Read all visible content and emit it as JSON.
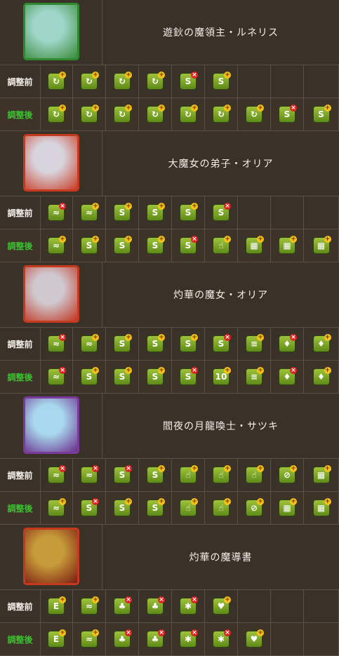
{
  "labels": {
    "before": "調整前",
    "after": "調整後"
  },
  "colors": {
    "background": "#3a3128",
    "after_label": "#39c22e",
    "awakening_bg": "#7aa82a"
  },
  "cards": [
    {
      "name": "遊鈥の魔領主・ルネリス",
      "portrait": {
        "main_color": "#9fd6c9",
        "accent": "#3a8b3a",
        "border": "#2f8a2f"
      },
      "before": [
        {
          "icon": "skill-boost-icon",
          "sym": "↻",
          "mod": "plus"
        },
        {
          "icon": "skill-boost-icon",
          "sym": "↻",
          "mod": "plus"
        },
        {
          "icon": "skill-boost-icon",
          "sym": "↻",
          "mod": "plus"
        },
        {
          "icon": "skill-boost-icon",
          "sym": "↻",
          "mod": "plus"
        },
        {
          "icon": "bind-resist-icon",
          "sym": "S",
          "mod": "cross"
        },
        {
          "icon": "bind-resist-icon",
          "sym": "S",
          "mod": "plus"
        }
      ],
      "after": [
        {
          "icon": "skill-boost-icon",
          "sym": "↻",
          "mod": "plus"
        },
        {
          "icon": "skill-boost-icon",
          "sym": "↻",
          "mod": "plus"
        },
        {
          "icon": "skill-boost-icon",
          "sym": "↻",
          "mod": "plus"
        },
        {
          "icon": "skill-boost-icon",
          "sym": "↻",
          "mod": "plus"
        },
        {
          "icon": "skill-boost-icon",
          "sym": "↻",
          "mod": "plus"
        },
        {
          "icon": "skill-boost-icon",
          "sym": "↻",
          "mod": "plus"
        },
        {
          "icon": "skill-boost-icon",
          "sym": "↻",
          "mod": "plus"
        },
        {
          "icon": "bind-resist-icon",
          "sym": "S",
          "mod": "cross"
        },
        {
          "icon": "bind-resist-icon",
          "sym": "S",
          "mod": "plus"
        }
      ]
    },
    {
      "name": "大魔女の弟子・オリア",
      "portrait": {
        "main_color": "#d8d4de",
        "accent": "#c93b22",
        "border": "#c33a1c"
      },
      "before": [
        {
          "icon": "bind-recovery-icon",
          "sym": "≈",
          "mod": "cross"
        },
        {
          "icon": "bind-recovery-icon",
          "sym": "≈",
          "mod": "plus"
        },
        {
          "icon": "orb-enhance-icon",
          "sym": "S",
          "mod": "plus"
        },
        {
          "icon": "orb-enhance-icon",
          "sym": "S",
          "mod": "plus"
        },
        {
          "icon": "bind-resist-icon",
          "sym": "S",
          "mod": "plus"
        },
        {
          "icon": "bind-resist-icon",
          "sym": "S",
          "mod": "cross"
        }
      ],
      "after": [
        {
          "icon": "bind-recovery-icon",
          "sym": "≈",
          "mod": "plus"
        },
        {
          "icon": "orb-enhance-icon",
          "sym": "S",
          "mod": "plus"
        },
        {
          "icon": "orb-enhance-icon",
          "sym": "S",
          "mod": "plus"
        },
        {
          "icon": "bind-resist-icon",
          "sym": "S",
          "mod": "plus"
        },
        {
          "icon": "bind-resist-icon",
          "sym": "S",
          "mod": "cross"
        },
        {
          "icon": "extend-time-icon",
          "sym": "☝",
          "mod": "plus"
        },
        {
          "icon": "damage-up-icon",
          "sym": "▦",
          "mod": "plus"
        },
        {
          "icon": "damage-up-icon",
          "sym": "▦",
          "mod": "plus"
        },
        {
          "icon": "damage-up-icon",
          "sym": "▦",
          "mod": "plus"
        }
      ]
    },
    {
      "name": "灼華の魔女・オリア",
      "portrait": {
        "main_color": "#cfc8cf",
        "accent": "#c23520",
        "border": "#c33a1c"
      },
      "before": [
        {
          "icon": "bind-recovery-icon",
          "sym": "≈",
          "mod": "cross"
        },
        {
          "icon": "bind-recovery-icon",
          "sym": "≈",
          "mod": "plus"
        },
        {
          "icon": "orb-enhance-icon",
          "sym": "S",
          "mod": "plus"
        },
        {
          "icon": "orb-enhance-icon",
          "sym": "S",
          "mod": "plus"
        },
        {
          "icon": "bind-resist-icon",
          "sym": "S",
          "mod": "plus"
        },
        {
          "icon": "bind-resist-icon",
          "sym": "S",
          "mod": "cross"
        },
        {
          "icon": "combo-icon",
          "sym": "≡",
          "mod": "plus"
        },
        {
          "icon": "heart-icon",
          "sym": "♦",
          "mod": "cross"
        },
        {
          "icon": "heart-icon",
          "sym": "♦",
          "mod": "plus"
        }
      ],
      "after": [
        {
          "icon": "bind-recovery-icon",
          "sym": "≈",
          "mod": "cross"
        },
        {
          "icon": "orb-enhance-icon",
          "sym": "S",
          "mod": "plus"
        },
        {
          "icon": "orb-enhance-icon",
          "sym": "S",
          "mod": "plus"
        },
        {
          "icon": "orb-enhance-icon",
          "sym": "S",
          "mod": "plus"
        },
        {
          "icon": "bind-resist-icon",
          "sym": "S",
          "mod": "cross"
        },
        {
          "icon": "ten-combo-icon",
          "sym": "10",
          "mod": "plus"
        },
        {
          "icon": "combo-icon",
          "sym": "≡",
          "mod": "plus"
        },
        {
          "icon": "heart-icon",
          "sym": "♦",
          "mod": "cross"
        },
        {
          "icon": "heart-icon",
          "sym": "♦",
          "mod": "plus"
        }
      ]
    },
    {
      "name": "閻夜の月龍喚士・サツキ",
      "portrait": {
        "main_color": "#a8d8ee",
        "accent": "#6a2c8c",
        "border": "#7a3a9a"
      },
      "before": [
        {
          "icon": "bind-recovery-icon",
          "sym": "≈",
          "mod": "cross"
        },
        {
          "icon": "bind-recovery-icon",
          "sym": "≈",
          "mod": "cross"
        },
        {
          "icon": "bind-resist-icon",
          "sym": "S",
          "mod": "cross"
        },
        {
          "icon": "orb-enhance-icon",
          "sym": "S",
          "mod": "plus"
        },
        {
          "icon": "extend-time-icon",
          "sym": "☝",
          "mod": "plus"
        },
        {
          "icon": "extend-time-icon",
          "sym": "☝",
          "mod": "plus"
        },
        {
          "icon": "extend-time-icon",
          "sym": "☝",
          "mod": "plus"
        },
        {
          "icon": "guard-break-icon",
          "sym": "⊘",
          "mod": "plus"
        },
        {
          "icon": "damage-up-icon",
          "sym": "▦",
          "mod": "plus"
        }
      ],
      "after": [
        {
          "icon": "bind-recovery-icon",
          "sym": "≈",
          "mod": "plus"
        },
        {
          "icon": "bind-resist-icon",
          "sym": "S",
          "mod": "cross"
        },
        {
          "icon": "orb-enhance-icon",
          "sym": "S",
          "mod": "plus"
        },
        {
          "icon": "orb-enhance-icon",
          "sym": "S",
          "mod": "plus"
        },
        {
          "icon": "extend-time-icon",
          "sym": "☝",
          "mod": "plus"
        },
        {
          "icon": "extend-time-icon",
          "sym": "☝",
          "mod": "plus"
        },
        {
          "icon": "guard-break-icon",
          "sym": "⊘",
          "mod": "plus"
        },
        {
          "icon": "damage-up-icon",
          "sym": "▦",
          "mod": "plus"
        },
        {
          "icon": "damage-up-icon",
          "sym": "▦",
          "mod": "plus"
        }
      ]
    },
    {
      "name": "灼華の魔導書",
      "portrait": {
        "main_color": "#c79a3a",
        "accent": "#7a1a10",
        "border": "#c33a1c"
      },
      "before": [
        {
          "icon": "enhanced-attack-icon",
          "sym": "E",
          "mod": "plus"
        },
        {
          "icon": "bind-recovery-icon",
          "sym": "≈",
          "mod": "plus"
        },
        {
          "icon": "dark-resist-icon",
          "sym": "♣",
          "mod": "cross"
        },
        {
          "icon": "dark-resist-icon",
          "sym": "♣",
          "mod": "cross"
        },
        {
          "icon": "poison-resist-icon",
          "sym": "✱",
          "mod": "cross"
        },
        {
          "icon": "heart-resist-icon",
          "sym": "♥",
          "mod": "plus"
        }
      ],
      "after": [
        {
          "icon": "enhanced-attack-icon",
          "sym": "E",
          "mod": "plus"
        },
        {
          "icon": "bind-recovery-icon",
          "sym": "≈",
          "mod": "plus"
        },
        {
          "icon": "dark-resist-icon",
          "sym": "♣",
          "mod": "cross"
        },
        {
          "icon": "dark-resist-icon",
          "sym": "♣",
          "mod": "cross"
        },
        {
          "icon": "poison-resist-icon",
          "sym": "✱",
          "mod": "cross"
        },
        {
          "icon": "poison-resist-icon",
          "sym": "✱",
          "mod": "cross"
        },
        {
          "icon": "heart-resist-icon",
          "sym": "♥",
          "mod": "plus"
        }
      ]
    }
  ]
}
